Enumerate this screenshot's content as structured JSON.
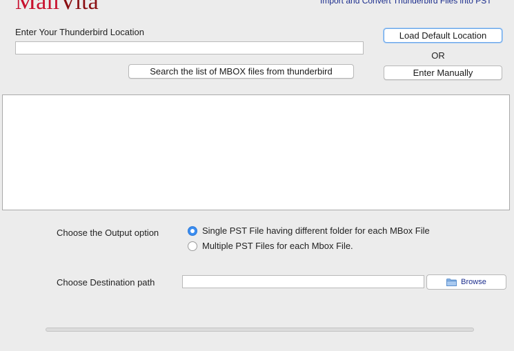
{
  "header": {
    "logo_part1": "Mail",
    "logo_part2": "Vita",
    "tagline": "Import and Convert Thunderbird Files into PST"
  },
  "location": {
    "label": "Enter Your Thunderbird Location",
    "value": "",
    "search_button": "Search the list of MBOX files from thunderbird"
  },
  "actions": {
    "load_default": "Load Default Location",
    "or_label": "OR",
    "enter_manually": "Enter Manually"
  },
  "output": {
    "label": "Choose the Output option",
    "options": [
      {
        "label": "Single PST File having different folder for each MBox File",
        "selected": true
      },
      {
        "label": "Multiple PST Files for each Mbox File.",
        "selected": false
      }
    ]
  },
  "destination": {
    "label": "Choose Destination path",
    "value": "",
    "browse_button": "Browse"
  },
  "progress": {
    "fraction": 0
  },
  "colors": {
    "accent": "#3b8df0",
    "logo_red": "#c8102e",
    "tagline_blue": "#1a2c8c"
  }
}
